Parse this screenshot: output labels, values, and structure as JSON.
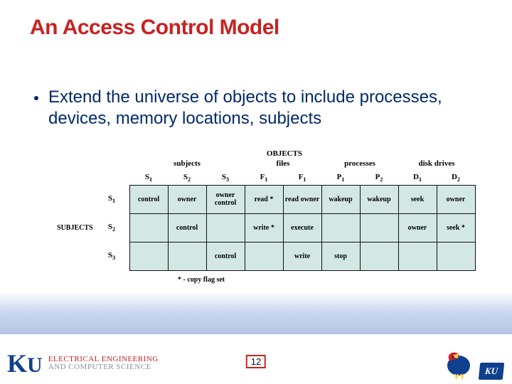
{
  "title": "An Access Control Model",
  "bullet": "Extend the universe of objects to include processes, devices, memory locations, subjects",
  "matrix": {
    "objects_label": "OBJECTS",
    "subjects_label": "SUBJECTS",
    "groups": [
      "subjects",
      "files",
      "processes",
      "disk drives"
    ],
    "cols": [
      "S1",
      "S2",
      "S3",
      "F1",
      "F1",
      "P1",
      "P2",
      "D1",
      "D2"
    ],
    "rows": [
      "S1",
      "S2",
      "S3"
    ],
    "cells": [
      [
        "control",
        "owner",
        "owner control",
        "read *",
        "read owner",
        "wakeup",
        "wakeup",
        "seek",
        "owner"
      ],
      [
        "",
        "control",
        "",
        "write *",
        "execute",
        "",
        "",
        "owner",
        "seek *"
      ],
      [
        "",
        "",
        "control",
        "",
        "write",
        "stop",
        "",
        "",
        ""
      ]
    ],
    "footnote": "* - copy flag set"
  },
  "page_number": "12",
  "footer": {
    "ku": "KU",
    "dept_line1": "ELECTRICAL ENGINEERING",
    "dept_line2": "AND COMPUTER SCIENCE",
    "badge": "KU"
  }
}
